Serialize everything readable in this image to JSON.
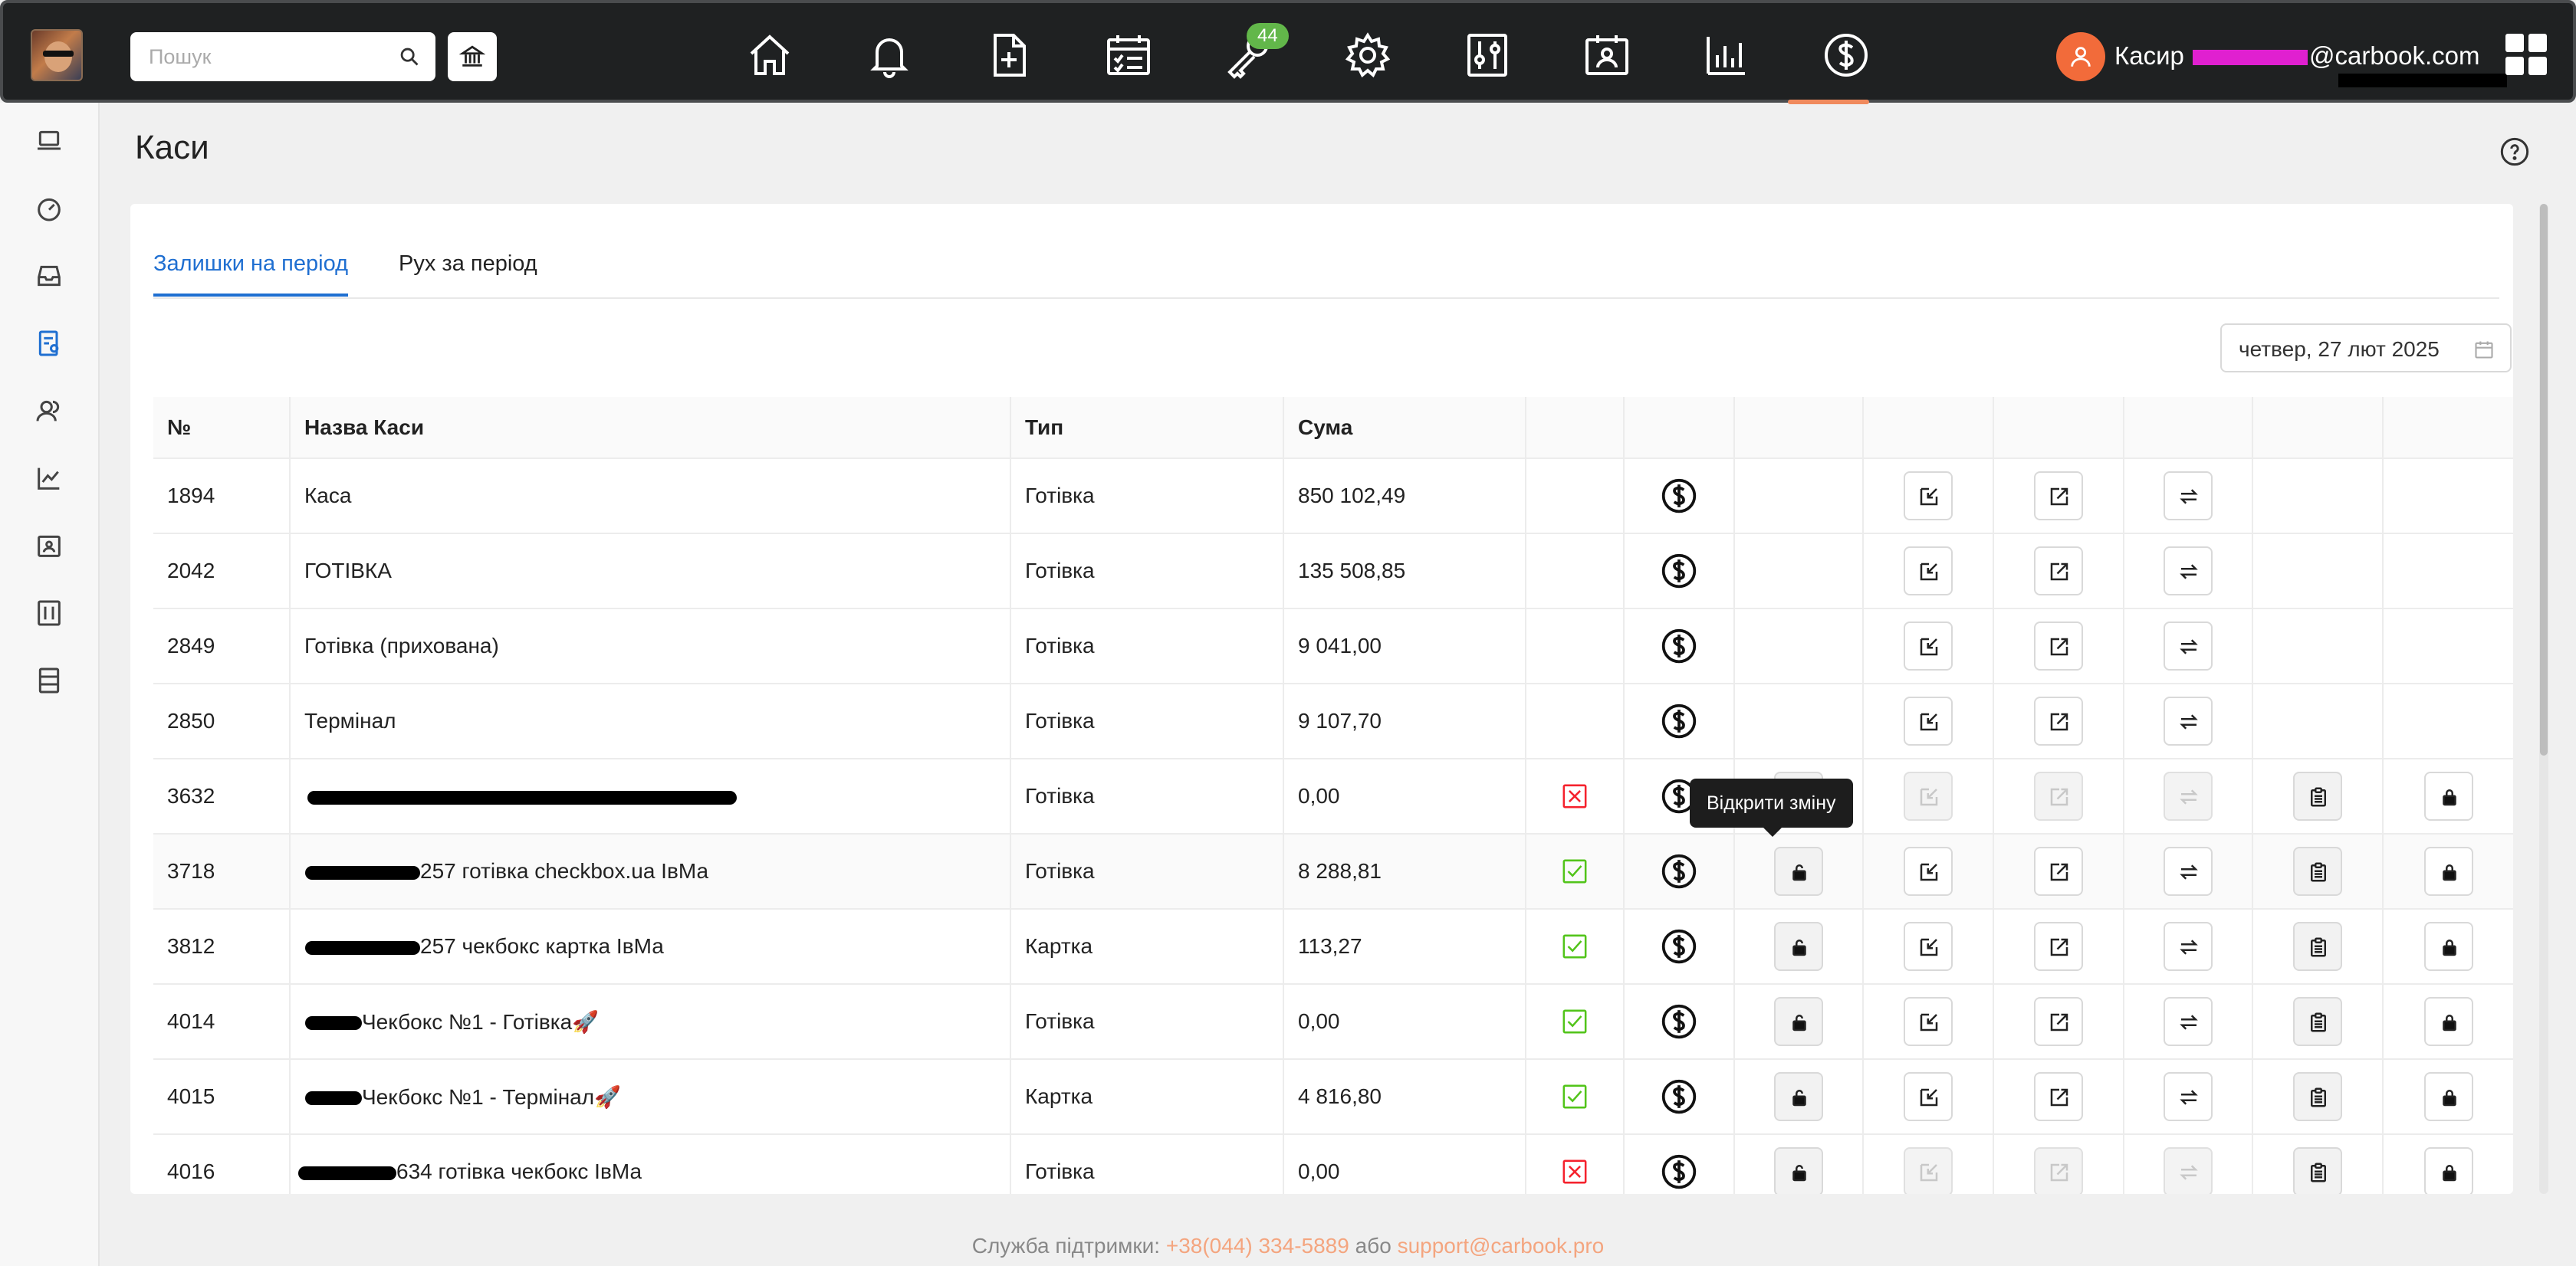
{
  "header": {
    "search_placeholder": "Пошук",
    "badge_count": "44",
    "user": {
      "role": "Касир",
      "email_suffix": "@carbook.com"
    },
    "nav": [
      {
        "icon": "home-icon"
      },
      {
        "icon": "bell-icon"
      },
      {
        "icon": "document-plus-icon"
      },
      {
        "icon": "calendar-check-icon"
      },
      {
        "icon": "wrench-key-icon"
      },
      {
        "icon": "gear-icon"
      },
      {
        "icon": "sliders-icon"
      },
      {
        "icon": "calendar-person-icon"
      },
      {
        "icon": "bar-chart-icon"
      },
      {
        "icon": "dollar-circle-icon"
      }
    ]
  },
  "page": {
    "title": "Каси"
  },
  "tabs": [
    {
      "label": "Залишки на період",
      "active": true
    },
    {
      "label": "Рух за період",
      "active": false
    }
  ],
  "date": "четвер, 27 лют 2025",
  "table": {
    "headers": [
      "№",
      "Назва Каси",
      "Тип",
      "Сума"
    ],
    "rows": [
      {
        "num": "1894",
        "name": "Каса",
        "type": "Готівка",
        "sum": "850 102,49"
      },
      {
        "num": "2042",
        "name": "ГОТІВКА",
        "type": "Готівка",
        "sum": "135 508,85"
      },
      {
        "num": "2849",
        "name": "Готівка (прихована)",
        "type": "Готівка",
        "sum": "9 041,00"
      },
      {
        "num": "2850",
        "name": "Термінал",
        "type": "Готівка",
        "sum": "9 107,70"
      },
      {
        "num": "3632",
        "name": "",
        "type": "Готівка",
        "sum": "0,00"
      },
      {
        "num": "3718",
        "name": "257 готівка checkbox.ua ІвМа",
        "type": "Готівка",
        "sum": "8 288,81"
      },
      {
        "num": "3812",
        "name": "257 чекбокс картка ІвМа",
        "type": "Картка",
        "sum": "113,27"
      },
      {
        "num": "4014",
        "name": "Чекбокс №1 - Готівка🚀",
        "type": "Готівка",
        "sum": "0,00"
      },
      {
        "num": "4015",
        "name": "Чекбокс №1 - Термінал🚀",
        "type": "Картка",
        "sum": "4 816,80"
      },
      {
        "num": "4016",
        "name": "634 готівка чекбокс ІвМа",
        "type": "Готівка",
        "sum": "0,00"
      }
    ]
  },
  "tooltip": "Відкрити зміну",
  "footer": {
    "prefix": "Служба підтримки:",
    "phone": "+38(044) 334-5889",
    "or": "або",
    "email": "support@carbook.pro"
  },
  "colors": {
    "accent": "#1f6fd1",
    "active_nav": "#f08a5d",
    "badge": "#62b74a",
    "avatar": "#f26b3a",
    "check_ok": "#52c41a",
    "check_no": "#f5222d"
  }
}
